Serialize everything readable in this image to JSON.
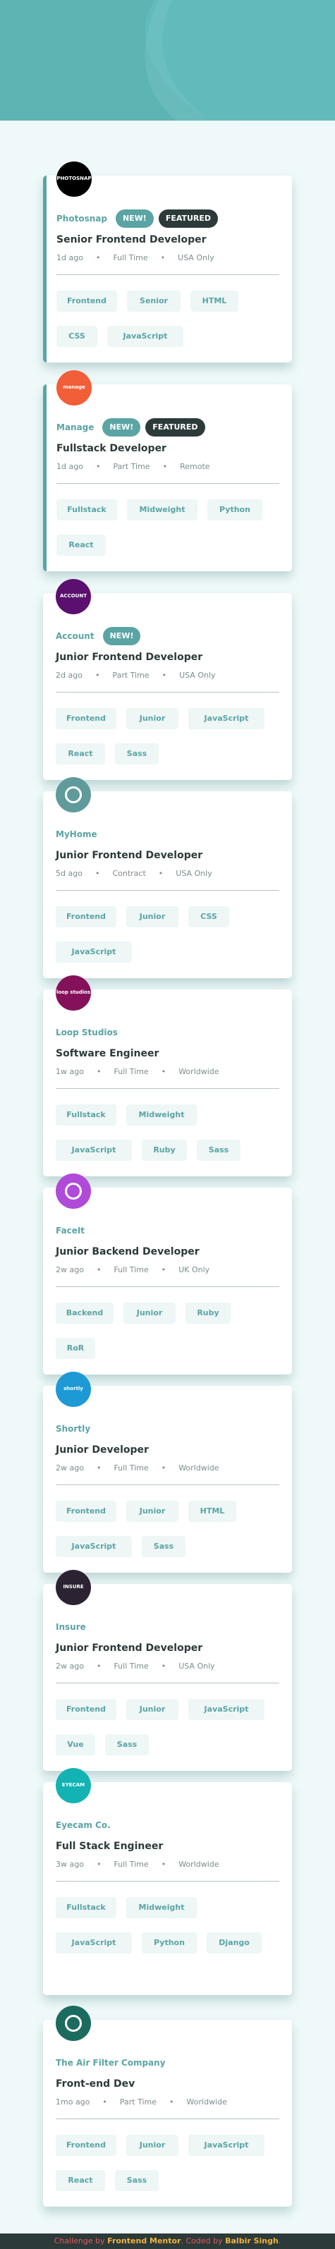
{
  "colors": {
    "primary": "#5ba4a4",
    "dark": "#2c3a3a",
    "muted": "#7b8e8e",
    "background": "#eff9f9",
    "tag_background": "#eef6f6",
    "header": "#62babb"
  },
  "badges": {
    "new": "NEW!",
    "featured": "FEATURED"
  },
  "jobs": [
    {
      "company": "Photosnap",
      "logo_text": "PHOTOSNAP",
      "logo_color": "#000000",
      "new": true,
      "featured": true,
      "position": "Senior Frontend Developer",
      "posted": "1d ago",
      "contract": "Full Time",
      "location": "USA Only",
      "tags": [
        "Frontend",
        "Senior",
        "HTML",
        "CSS",
        "JavaScript"
      ]
    },
    {
      "company": "Manage",
      "logo_text": "manage",
      "logo_color": "#f15e37",
      "new": true,
      "featured": true,
      "position": "Fullstack Developer",
      "posted": "1d ago",
      "contract": "Part Time",
      "location": "Remote",
      "tags": [
        "Fullstack",
        "Midweight",
        "Python",
        "React"
      ]
    },
    {
      "company": "Account",
      "logo_text": "ACCOUNT",
      "logo_color": "#5b0f6e",
      "new": true,
      "featured": false,
      "position": "Junior Frontend Developer",
      "posted": "2d ago",
      "contract": "Part Time",
      "location": "USA Only",
      "tags": [
        "Frontend",
        "Junior",
        "JavaScript",
        "React",
        "Sass"
      ]
    },
    {
      "company": "MyHome",
      "logo_text": "",
      "logo_color": "#5f9b9b",
      "new": false,
      "featured": false,
      "position": "Junior Frontend Developer",
      "posted": "5d ago",
      "contract": "Contract",
      "location": "USA Only",
      "tags": [
        "Frontend",
        "Junior",
        "CSS",
        "JavaScript"
      ]
    },
    {
      "company": "Loop Studios",
      "logo_text": "loop studios",
      "logo_color": "#85115b",
      "new": false,
      "featured": false,
      "position": "Software Engineer",
      "posted": "1w ago",
      "contract": "Full Time",
      "location": "Worldwide",
      "tags": [
        "Fullstack",
        "Midweight",
        "JavaScript",
        "Ruby",
        "Sass"
      ]
    },
    {
      "company": "FaceIt",
      "logo_text": "",
      "logo_color": "#b04ad8",
      "new": false,
      "featured": false,
      "position": "Junior Backend Developer",
      "posted": "2w ago",
      "contract": "Full Time",
      "location": "UK Only",
      "tags": [
        "Backend",
        "Junior",
        "Ruby",
        "RoR"
      ]
    },
    {
      "company": "Shortly",
      "logo_text": "shortly",
      "logo_color": "#1d9ad6",
      "new": false,
      "featured": false,
      "position": "Junior Developer",
      "posted": "2w ago",
      "contract": "Full Time",
      "location": "Worldwide",
      "tags": [
        "Frontend",
        "Junior",
        "HTML",
        "JavaScript",
        "Sass"
      ]
    },
    {
      "company": "Insure",
      "logo_text": "INSURE",
      "logo_color": "#2c2332",
      "new": false,
      "featured": false,
      "position": "Junior Frontend Developer",
      "posted": "2w ago",
      "contract": "Full Time",
      "location": "USA Only",
      "tags": [
        "Frontend",
        "Junior",
        "JavaScript",
        "Vue",
        "Sass"
      ]
    },
    {
      "company": "Eyecam Co.",
      "logo_text": "EYECAM",
      "logo_color": "#13b3b3",
      "new": false,
      "featured": false,
      "position": "Full Stack Engineer",
      "posted": "3w ago",
      "contract": "Full Time",
      "location": "Worldwide",
      "tags": [
        "Fullstack",
        "Midweight",
        "JavaScript",
        "Python",
        "Django"
      ]
    },
    {
      "company": "The Air Filter Company",
      "logo_text": "",
      "logo_color": "#1c6b5f",
      "new": false,
      "featured": false,
      "position": "Front-end Dev",
      "posted": "1mo ago",
      "contract": "Part Time",
      "location": "Worldwide",
      "tags": [
        "Frontend",
        "Junior",
        "JavaScript",
        "React",
        "Sass"
      ]
    }
  ],
  "footer": {
    "prefix": "Challenge by ",
    "brand": "Frontend Mentor",
    "middle": ". Coded by ",
    "author": "Balbir Singh",
    "suffix": "."
  }
}
